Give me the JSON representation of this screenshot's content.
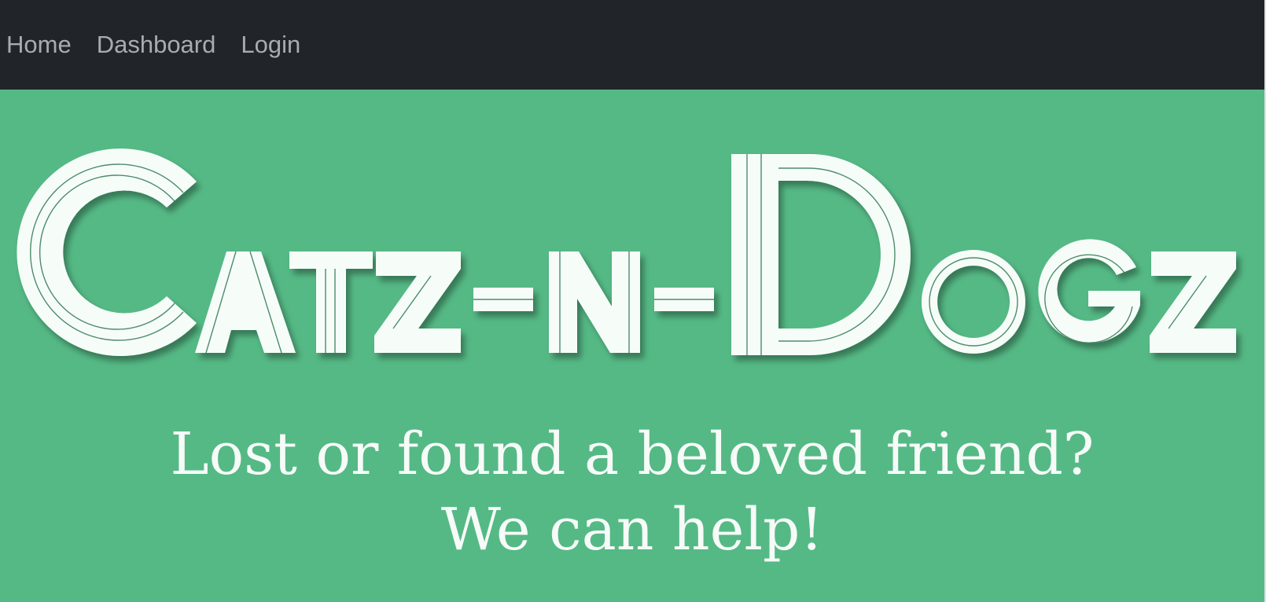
{
  "nav": {
    "items": [
      "Home",
      "Dashboard",
      "Login"
    ]
  },
  "hero": {
    "logo_text": "Catz-n-Dogz",
    "tagline_line1": "Lost or found a beloved friend?",
    "tagline_line2": "We can help!"
  },
  "colors": {
    "navbar_bg": "#212529",
    "nav_text": "#a9acaf",
    "hero_bg": "#55b985",
    "logo_fill": "#f6fdf9",
    "logo_inline": "#3c7f5b",
    "tagline_text": "#f6fbf8"
  }
}
